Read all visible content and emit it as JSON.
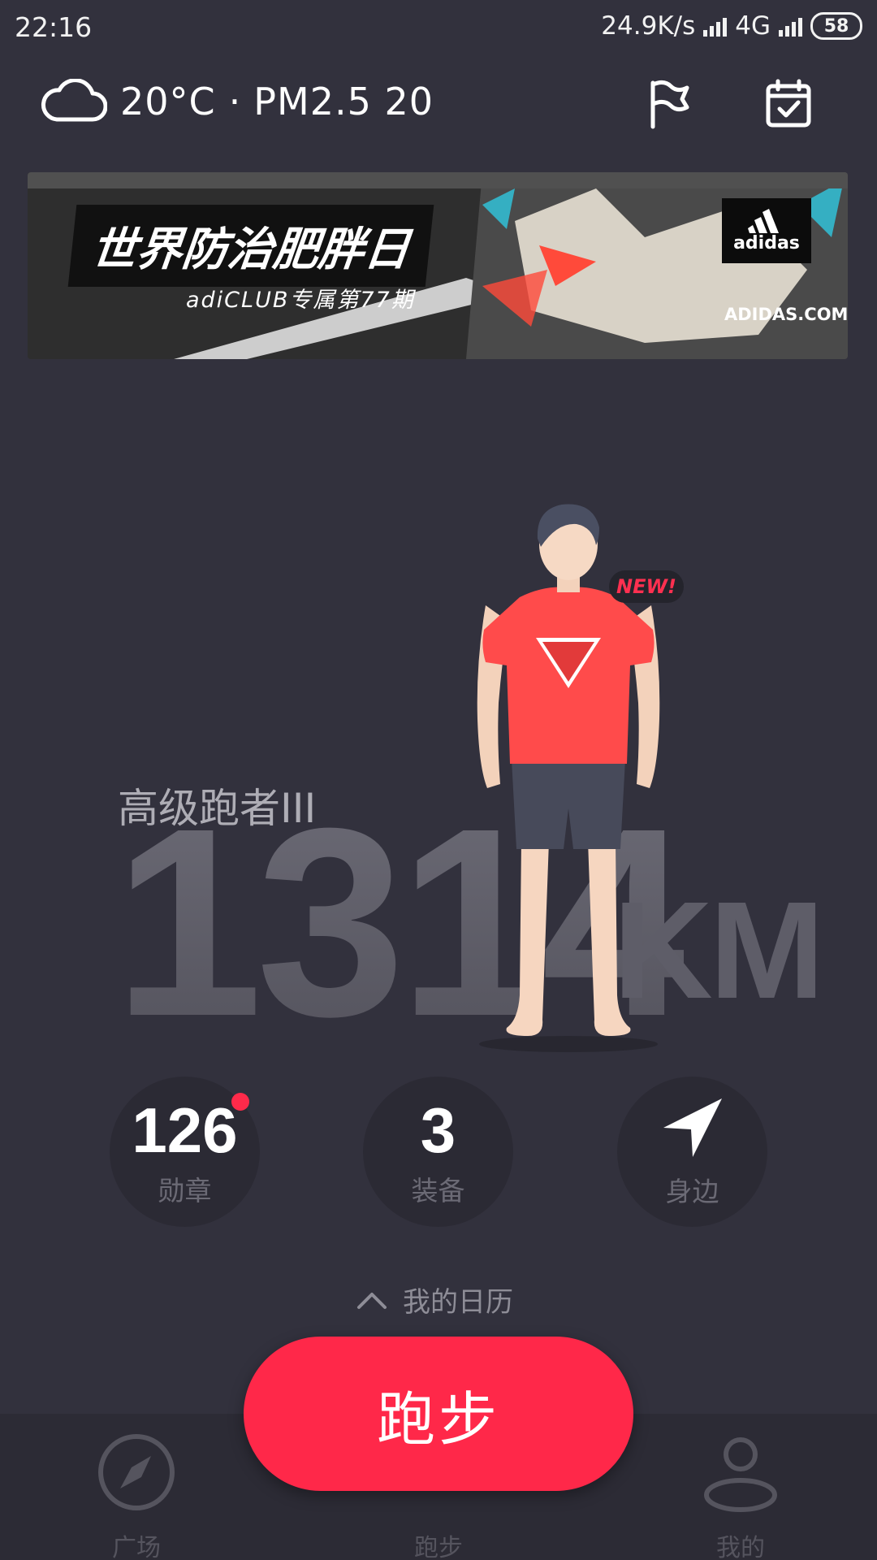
{
  "status_bar": {
    "time": "22:16",
    "net_speed": "24.9K/s",
    "network_type": "4G",
    "battery": "58"
  },
  "header": {
    "temperature": "20°C",
    "separator": "·",
    "air_quality": "PM2.5 20",
    "icons": [
      "cloud-icon",
      "flag-icon",
      "calendar-check-icon"
    ]
  },
  "banner": {
    "title": "世界防治肥胖日",
    "subtitle": "adiCLUB专属第77期",
    "brand": "adidas",
    "url": "ADIDAS.COM"
  },
  "profile": {
    "level": "高级跑者III",
    "distance": "1314",
    "unit": "KM",
    "new_badge": "NEW!"
  },
  "stats": [
    {
      "value": "126",
      "label": "勋章",
      "has_notification": true
    },
    {
      "value": "3",
      "label": "装备"
    },
    {
      "label": "身边",
      "icon": "navigation-arrow-icon"
    }
  ],
  "calendar_toggle": {
    "label": "我的日历",
    "icon": "chevron-up-icon"
  },
  "run_button": {
    "label": "跑步"
  },
  "bottom_nav": {
    "items": [
      {
        "label": "广场",
        "icon": "compass-icon"
      },
      {
        "label": "跑步"
      },
      {
        "label": "我的",
        "icon": "user-icon"
      }
    ]
  },
  "colors": {
    "background": "#32313d",
    "accent": "#ff2849",
    "nav_background": "#2c2b35"
  }
}
